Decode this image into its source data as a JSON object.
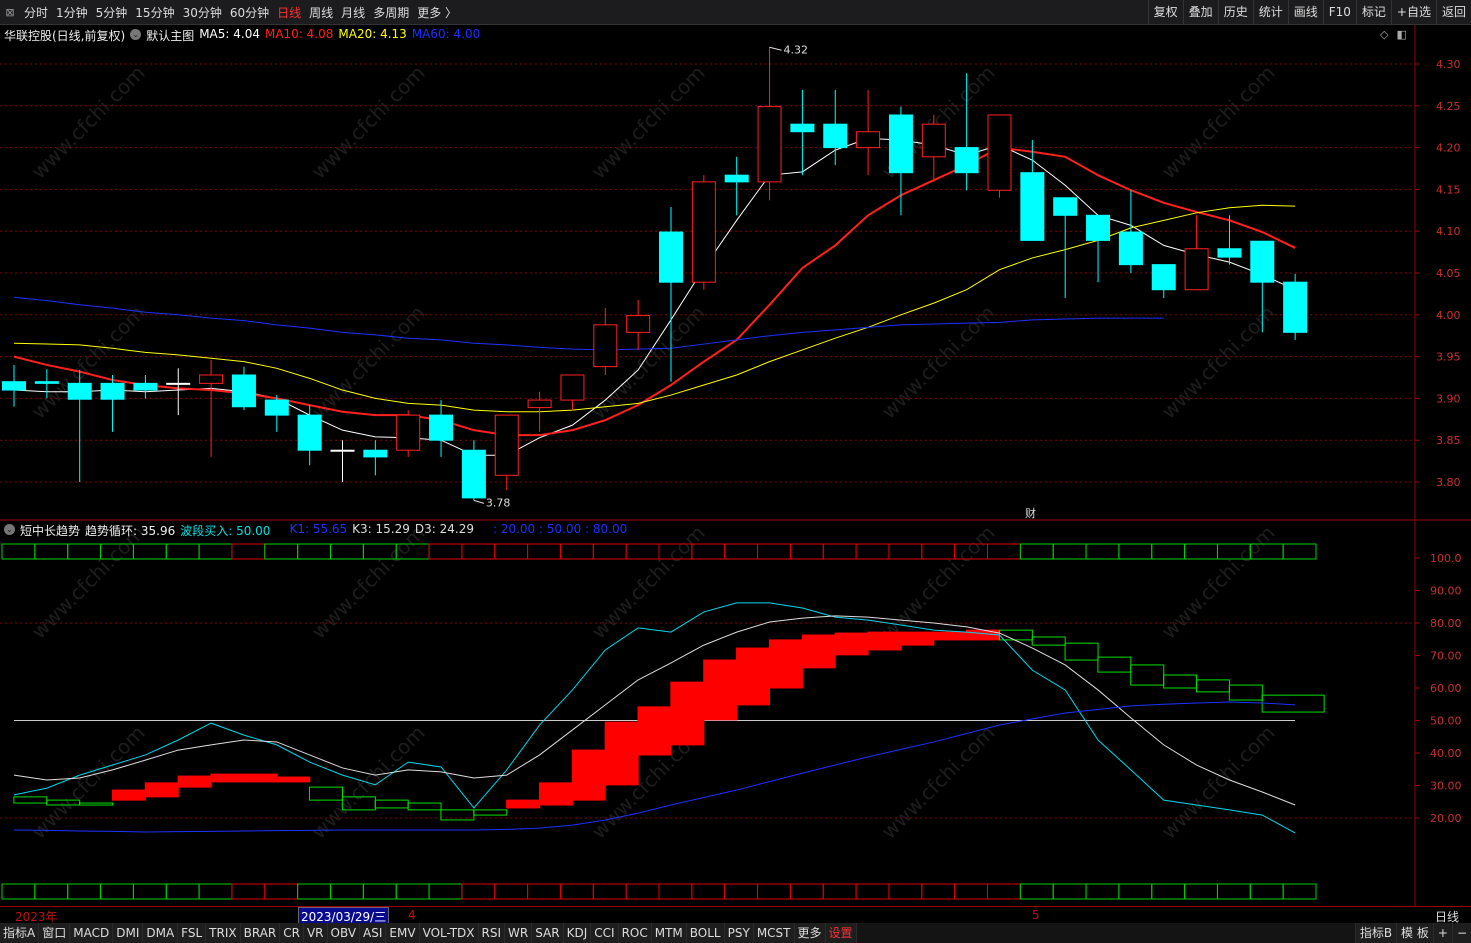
{
  "toolbar": {
    "periods": [
      "分时",
      "1分钟",
      "5分钟",
      "15分钟",
      "30分钟",
      "60分钟",
      "日线",
      "周线",
      "月线",
      "多周期",
      "更多 〉"
    ],
    "active_period": "日线",
    "actions": [
      "复权",
      "叠加",
      "历史",
      "统计",
      "画线",
      "F10",
      "标记",
      "+自选",
      "返回"
    ]
  },
  "legend": {
    "stock": "华联控股(日线,前复权)",
    "template": "默认主图",
    "ma5": "MA5: 4.04",
    "ma10": "MA10: 4.08",
    "ma20": "MA20: 4.13",
    "ma60": "MA60: 4.00"
  },
  "indicator_legend": {
    "name": "短中长趋势",
    "trend": "趋势循环: 35.96",
    "buy": "波段买入: 50.00",
    "k1": "K1: 55.65",
    "k3": "K3: 15.29",
    "d3": "D3: 24.29",
    "levels": ": 20.00 : 50.00 : 80.00"
  },
  "colors": {
    "up": "#ff2020",
    "down": "#00ffff",
    "ma5": "#ffffff",
    "ma10": "#ff2020",
    "ma20": "#ffff00",
    "ma60": "#1e30ff",
    "grid": "#8a0000"
  },
  "annotations": {
    "high": "4.32",
    "low": "3.78",
    "finance_marker": "财"
  },
  "price_axis": [
    "4.30",
    "4.25",
    "4.20",
    "4.15",
    "4.10",
    "4.05",
    "4.00",
    "3.95",
    "3.90",
    "3.85",
    "3.80"
  ],
  "indicator_axis": [
    "100.0",
    "90.00",
    "80.00",
    "70.00",
    "60.00",
    "50.00",
    "40.00",
    "30.00",
    "20.00"
  ],
  "date_axis": {
    "year": "2023年",
    "selected": "2023/03/29/三",
    "april": "4",
    "may": "5",
    "period": "日线"
  },
  "tabs_left": [
    "指标A",
    "窗口",
    "MACD",
    "DMI",
    "DMA",
    "FSL",
    "TRIX",
    "BRAR",
    "CR",
    "VR",
    "OBV",
    "ASI",
    "EMV",
    "VOL-TDX",
    "RSI",
    "WR",
    "SAR",
    "KDJ",
    "CCI",
    "ROC",
    "MTM",
    "BOLL",
    "PSY",
    "MCST",
    "更多",
    "设置"
  ],
  "tabs_right": [
    "指标B",
    "模 板",
    "+",
    "−"
  ],
  "watermark": "www.cfchi.com",
  "chart_data": [
    {
      "type": "candlestick",
      "title": "华联控股(日线,前复权)",
      "ylim": [
        3.78,
        4.32
      ],
      "ohlc": [
        [
          3.92,
          3.91,
          3.94,
          3.89
        ],
        [
          3.92,
          3.918,
          3.935,
          3.9
        ],
        [
          3.918,
          3.899,
          3.934,
          3.8
        ],
        [
          3.918,
          3.899,
          3.928,
          3.86
        ],
        [
          3.918,
          3.91,
          3.928,
          3.9
        ],
        [
          3.918,
          3.918,
          3.936,
          3.88
        ],
        [
          3.918,
          3.928,
          3.946,
          3.83
        ],
        [
          3.928,
          3.89,
          3.938,
          3.886
        ],
        [
          3.898,
          3.88,
          3.904,
          3.86
        ],
        [
          3.88,
          3.838,
          3.892,
          3.82
        ],
        [
          3.838,
          3.838,
          3.85,
          3.8
        ],
        [
          3.838,
          3.83,
          3.85,
          3.808
        ],
        [
          3.838,
          3.88,
          3.886,
          3.83
        ],
        [
          3.88,
          3.85,
          3.898,
          3.83
        ],
        [
          3.838,
          3.781,
          3.85,
          3.778
        ],
        [
          3.808,
          3.88,
          3.88,
          3.79
        ],
        [
          3.889,
          3.898,
          3.908,
          3.86
        ],
        [
          3.898,
          3.928,
          3.928,
          3.886
        ],
        [
          3.938,
          3.988,
          4.008,
          3.928
        ],
        [
          3.979,
          3.999,
          4.018,
          3.958
        ],
        [
          4.099,
          4.039,
          4.129,
          3.92
        ],
        [
          4.039,
          4.159,
          4.167,
          4.03
        ],
        [
          4.167,
          4.159,
          4.189,
          4.119
        ],
        [
          4.159,
          4.249,
          4.32,
          4.137
        ],
        [
          4.228,
          4.219,
          4.269,
          4.167
        ],
        [
          4.228,
          4.2,
          4.269,
          4.179
        ],
        [
          4.2,
          4.219,
          4.269,
          4.167
        ],
        [
          4.239,
          4.17,
          4.249,
          4.119
        ],
        [
          4.189,
          4.228,
          4.239,
          4.159
        ],
        [
          4.2,
          4.17,
          4.289,
          4.149
        ],
        [
          4.149,
          4.239,
          4.239,
          4.14
        ],
        [
          4.17,
          4.089,
          4.209,
          4.089
        ],
        [
          4.14,
          4.119,
          4.14,
          4.02
        ],
        [
          4.119,
          4.089,
          4.119,
          4.039
        ],
        [
          4.099,
          4.06,
          4.149,
          4.05
        ],
        [
          4.06,
          4.03,
          4.06,
          4.02
        ],
        [
          4.03,
          4.079,
          4.119,
          4.03
        ],
        [
          4.079,
          4.069,
          4.119,
          4.06
        ],
        [
          4.088,
          4.039,
          4.088,
          3.979
        ],
        [
          4.039,
          3.979,
          4.049,
          3.97
        ]
      ],
      "series": [
        {
          "name": "MA5",
          "values": [
            3.91,
            3.908,
            3.908,
            3.91,
            3.908,
            3.91,
            3.912,
            3.908,
            3.9,
            3.88,
            3.862,
            3.854,
            3.853,
            3.85,
            3.832,
            3.832,
            3.853,
            3.868,
            3.898,
            3.934,
            3.994,
            4.056,
            4.113,
            4.167,
            4.171,
            4.197,
            4.211,
            4.209,
            4.203,
            4.191,
            4.203,
            4.185,
            4.155,
            4.119,
            4.107,
            4.083,
            4.072,
            4.063,
            4.048,
            4.03
          ]
        },
        {
          "name": "MA10",
          "values": [
            3.95,
            3.94,
            3.932,
            3.922,
            3.916,
            3.912,
            3.91,
            3.906,
            3.9,
            3.892,
            3.884,
            3.88,
            3.88,
            3.874,
            3.862,
            3.856,
            3.856,
            3.862,
            3.874,
            3.892,
            3.916,
            3.944,
            3.97,
            4.012,
            4.056,
            4.083,
            4.119,
            4.143,
            4.161,
            4.179,
            4.2,
            4.195,
            4.189,
            4.167,
            4.149,
            4.134,
            4.123,
            4.113,
            4.099,
            4.08
          ]
        },
        {
          "name": "MA20",
          "values": [
            3.966,
            3.965,
            3.964,
            3.96,
            3.955,
            3.952,
            3.948,
            3.944,
            3.936,
            3.924,
            3.91,
            3.9,
            3.894,
            3.892,
            3.886,
            3.884,
            3.884,
            3.886,
            3.89,
            3.894,
            3.904,
            3.916,
            3.928,
            3.944,
            3.958,
            3.972,
            3.985,
            4.0,
            4.014,
            4.03,
            4.054,
            4.068,
            4.078,
            4.089,
            4.104,
            4.113,
            4.122,
            4.128,
            4.131,
            4.13
          ]
        },
        {
          "name": "MA60",
          "values": [
            4.021,
            4.017,
            4.012,
            4.008,
            4.003,
            4.0,
            3.996,
            3.993,
            3.988,
            3.984,
            3.979,
            3.976,
            3.972,
            3.97,
            3.966,
            3.964,
            3.961,
            3.959,
            3.958,
            3.959,
            3.96,
            3.965,
            3.97,
            3.975,
            3.979,
            3.982,
            3.985,
            3.988,
            3.989,
            3.99,
            3.991,
            3.994,
            3.995,
            3.996,
            3.996,
            3.996,
            null,
            null,
            null,
            null
          ]
        }
      ]
    },
    {
      "type": "line",
      "title": "短中长趋势",
      "ylim": [
        15,
        100
      ],
      "series": [
        {
          "name": "波段买入",
          "values": [
            27.1,
            29.2,
            33.2,
            36.3,
            39.4,
            44.0,
            49.2,
            45.5,
            42.5,
            37.2,
            33.2,
            30.2,
            37.2,
            35.7,
            23.1,
            34.8,
            48.6,
            59.4,
            71.7,
            78.5,
            77.2,
            83.4,
            86.2,
            86.2,
            84.6,
            81.8,
            80.9,
            79.4,
            77.8,
            77.2,
            76.3,
            65.5,
            59.4,
            44.0,
            34.8,
            25.5,
            24.0,
            22.5,
            20.9,
            15.4
          ]
        },
        {
          "name": "K3",
          "values": [
            33.2,
            31.7,
            32.3,
            34.8,
            37.8,
            40.9,
            42.5,
            44.0,
            43.4,
            39.4,
            35.4,
            33.2,
            34.8,
            34.2,
            32.3,
            33.2,
            39.4,
            47.1,
            54.8,
            62.5,
            67.7,
            73.2,
            77.2,
            80.3,
            81.5,
            82.2,
            81.8,
            80.9,
            80.0,
            78.8,
            76.9,
            72.3,
            67.1,
            59.4,
            50.8,
            42.5,
            36.3,
            31.7,
            28.0,
            24.0
          ]
        },
        {
          "name": "MA-long",
          "values": [
            16.3,
            16.2,
            16.0,
            15.9,
            15.7,
            15.8,
            15.9,
            16.0,
            16.1,
            16.2,
            16.3,
            16.3,
            16.3,
            16.3,
            16.3,
            16.5,
            16.9,
            17.8,
            19.4,
            21.5,
            24.0,
            26.3,
            28.6,
            31.2,
            33.8,
            36.3,
            38.8,
            41.1,
            43.4,
            46.0,
            48.6,
            50.5,
            52.3,
            53.4,
            54.5,
            55.0,
            55.4,
            55.7,
            55.4,
            54.8
          ]
        }
      ],
      "trend_bars": [
        [
          24.6,
          26.5,
          "down"
        ],
        [
          24.0,
          25.5,
          "down"
        ],
        [
          24.0,
          24.6,
          "down"
        ],
        [
          25.5,
          28.6,
          "up"
        ],
        [
          26.5,
          30.8,
          "up"
        ],
        [
          29.5,
          32.9,
          "up"
        ],
        [
          31.1,
          33.5,
          "up"
        ],
        [
          31.1,
          33.5,
          "up"
        ],
        [
          31.1,
          32.6,
          "up"
        ],
        [
          25.5,
          29.5,
          "down"
        ],
        [
          22.5,
          26.5,
          "down"
        ],
        [
          23.1,
          25.5,
          "down"
        ],
        [
          22.5,
          24.6,
          "down"
        ],
        [
          19.4,
          22.5,
          "down"
        ],
        [
          20.9,
          22.5,
          "down"
        ],
        [
          23.1,
          25.5,
          "up"
        ],
        [
          24.0,
          30.8,
          "up"
        ],
        [
          25.5,
          40.9,
          "up"
        ],
        [
          30.2,
          49.5,
          "up"
        ],
        [
          39.4,
          54.2,
          "up"
        ],
        [
          42.5,
          61.8,
          "up"
        ],
        [
          50.2,
          68.6,
          "up"
        ],
        [
          54.8,
          72.3,
          "up"
        ],
        [
          60.0,
          74.8,
          "up"
        ],
        [
          66.2,
          76.3,
          "up"
        ],
        [
          70.2,
          76.9,
          "up"
        ],
        [
          71.7,
          77.2,
          "up"
        ],
        [
          73.2,
          77.2,
          "up"
        ],
        [
          74.8,
          77.2,
          "up"
        ],
        [
          74.8,
          77.8,
          "up"
        ],
        [
          74.8,
          77.8,
          "down"
        ],
        [
          73.2,
          75.7,
          "down"
        ],
        [
          68.6,
          73.8,
          "down"
        ],
        [
          64.9,
          69.5,
          "down"
        ],
        [
          60.9,
          67.1,
          "down"
        ],
        [
          60.0,
          64.0,
          "down"
        ],
        [
          58.8,
          62.5,
          "down"
        ],
        [
          56.3,
          60.9,
          "down"
        ],
        [
          52.6,
          57.8,
          "down"
        ]
      ],
      "signal_strip_top": [
        "down",
        "down",
        "down",
        "down",
        "down",
        "down",
        "down",
        "up",
        "down",
        "down",
        "down",
        "down",
        "down",
        "up",
        "up",
        "up",
        "up",
        "up",
        "up",
        "up",
        "up",
        "up",
        "up",
        "up",
        "up",
        "up",
        "up",
        "up",
        "up",
        "up",
        "up",
        "down",
        "down",
        "down",
        "down",
        "down",
        "down",
        "down",
        "down",
        "down"
      ],
      "signal_strip_bottom": [
        "down",
        "down",
        "down",
        "down",
        "down",
        "down",
        "down",
        "up",
        "up",
        "down",
        "down",
        "down",
        "down",
        "down",
        "up",
        "up",
        "up",
        "up",
        "up",
        "up",
        "up",
        "up",
        "up",
        "up",
        "up",
        "up",
        "up",
        "up",
        "up",
        "up",
        "up",
        "down",
        "down",
        "down",
        "down",
        "down",
        "down",
        "down",
        "down",
        "down"
      ],
      "reference_line": 50
    }
  ]
}
